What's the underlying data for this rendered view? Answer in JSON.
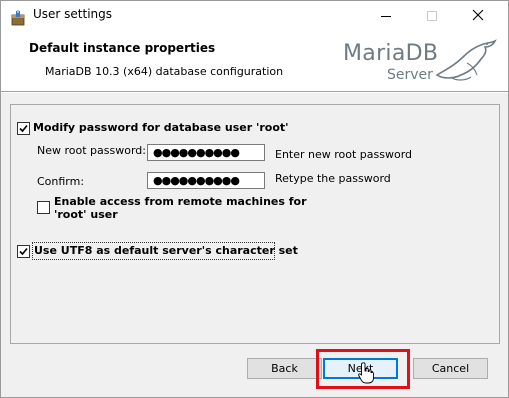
{
  "window": {
    "title": "User settings",
    "app_icon": "installer-package-icon",
    "controls": {
      "minimize": "minimize-icon",
      "maximize": "maximize-icon",
      "close": "close-icon"
    }
  },
  "header": {
    "title": "Default instance properties",
    "subtitle": "MariaDB 10.3 (x64) database configuration",
    "logo": {
      "brand": "MariaDB",
      "product": "Server",
      "icon": "sea-lion-logo"
    }
  },
  "form": {
    "modify_password": {
      "label": "Modify password for database user 'root'",
      "checked": true
    },
    "new_root_password": {
      "label": "New root password:",
      "value": "●●●●●●●●●●",
      "hint": "Enter new root password"
    },
    "confirm": {
      "label": "Confirm:",
      "value": "●●●●●●●●●●",
      "hint": "Retype the password"
    },
    "remote_access": {
      "label_line1": "Enable access from remote machines for",
      "label_line2": "'root' user",
      "checked": false
    },
    "utf8": {
      "label": "Use UTF8 as default server's character set",
      "checked": true
    }
  },
  "buttons": {
    "back": "Back",
    "next": "Next",
    "cancel": "Cancel"
  },
  "annotation": {
    "highlight_color": "#e0101b",
    "cursor": "hand-pointer-icon"
  }
}
